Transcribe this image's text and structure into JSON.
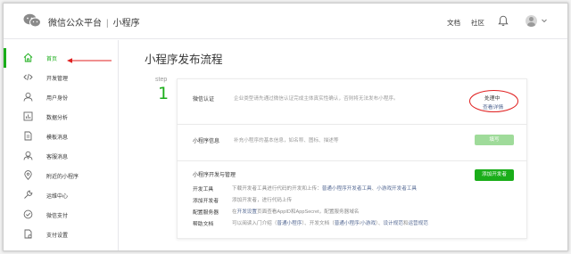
{
  "header": {
    "brand": "微信公众平台",
    "separator": "|",
    "product": "小程序",
    "nav": [
      "文档",
      "社区"
    ]
  },
  "sidebar": {
    "items": [
      {
        "label": "首页",
        "icon": "home-icon",
        "active": true
      },
      {
        "label": "开发管理",
        "icon": "code-icon"
      },
      {
        "label": "用户身份",
        "icon": "user-icon"
      },
      {
        "label": "数据分析",
        "icon": "chart-icon"
      },
      {
        "label": "模板消息",
        "icon": "document-icon"
      },
      {
        "label": "客服消息",
        "icon": "customer-service-icon"
      },
      {
        "label": "附近的小程序",
        "icon": "location-pin-icon"
      },
      {
        "label": "运维中心",
        "icon": "wrench-icon"
      },
      {
        "label": "微信支付",
        "icon": "pay-icon"
      },
      {
        "label": "支付设置",
        "icon": "payment-settings-icon"
      }
    ]
  },
  "main": {
    "title": "小程序发布流程",
    "step_label": "step",
    "step_number": "1",
    "auth": {
      "title": "微信认证",
      "desc": "企业类型请先通过微信认证完成主体真实性确认，否则将无法发布小程序。",
      "status": "处理中",
      "link": "查看详情"
    },
    "info": {
      "title": "小程序信息",
      "desc": "补充小程序的基本信息，如名称、图标、描述等",
      "button": "填写"
    },
    "dev": {
      "title": "小程序开发与管理",
      "button": "添加开发者",
      "rows": [
        {
          "label": "开发工具",
          "parts": [
            {
              "t": "下载开发者工具进行代码的开发和上传："
            },
            {
              "t": "普通小程序开发者工具",
              "link": true
            },
            {
              "t": "、"
            },
            {
              "t": "小游戏开发者工具",
              "link": true
            }
          ]
        },
        {
          "label": "添加开发者",
          "parts": [
            {
              "t": "添加开发者，进行代码上传"
            }
          ]
        },
        {
          "label": "配置服务器",
          "parts": [
            {
              "t": "在"
            },
            {
              "t": "开发设置",
              "link": true
            },
            {
              "t": "页面查看AppID和AppSecret，配置服务器域名"
            }
          ]
        },
        {
          "label": "帮助文档",
          "parts": [
            {
              "t": "可以阅读入门介绍（"
            },
            {
              "t": "普通小程序",
              "link": true
            },
            {
              "t": "）、开发文档（"
            },
            {
              "t": "普通小程序",
              "link": true
            },
            {
              "t": "/"
            },
            {
              "t": "小游戏",
              "link": true
            },
            {
              "t": "）、"
            },
            {
              "t": "设计规范",
              "link": true
            },
            {
              "t": "和"
            },
            {
              "t": "运营规范",
              "link": true
            }
          ]
        }
      ]
    }
  },
  "colors": {
    "accent": "#1aad19",
    "link": "#576b95",
    "annotation": "#e02020"
  }
}
